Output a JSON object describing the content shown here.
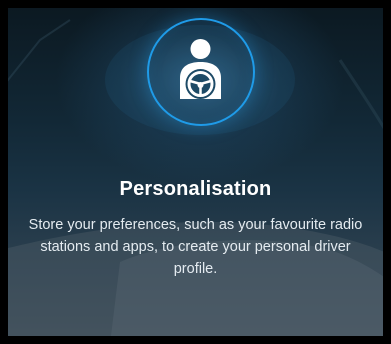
{
  "card": {
    "icon": "driver-steering-wheel-icon",
    "accent_color": "#1f9be8",
    "title": "Personalisation",
    "description": "Store your preferences, such as your favourite radio stations and apps, to create your personal driver profile."
  }
}
